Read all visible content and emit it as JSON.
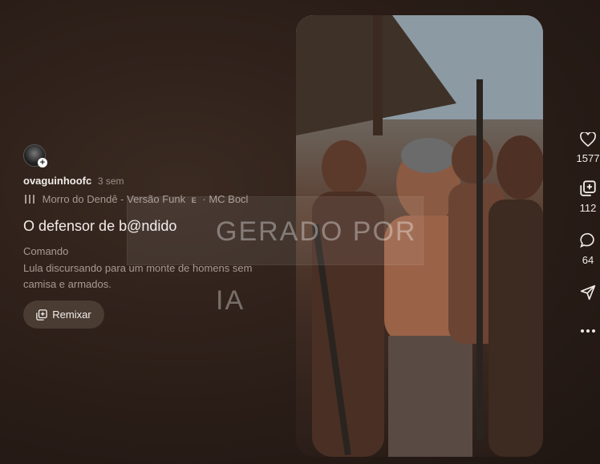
{
  "post": {
    "username": "ovaguinhoofc",
    "time": "3 sem",
    "music": "Morro do Dendê - Versão Funk",
    "explicit": "E",
    "artist": "· MC Bocl",
    "title": "O defensor de b@ndido",
    "section_label": "Comando",
    "description": "Lula discursando para um monte de homens sem camisa e armados.",
    "remix_label": "Remixar"
  },
  "media": {
    "watermark": "GERADO POR IA"
  },
  "actions": {
    "likes": "1577",
    "remixes": "112",
    "comments": "64"
  }
}
